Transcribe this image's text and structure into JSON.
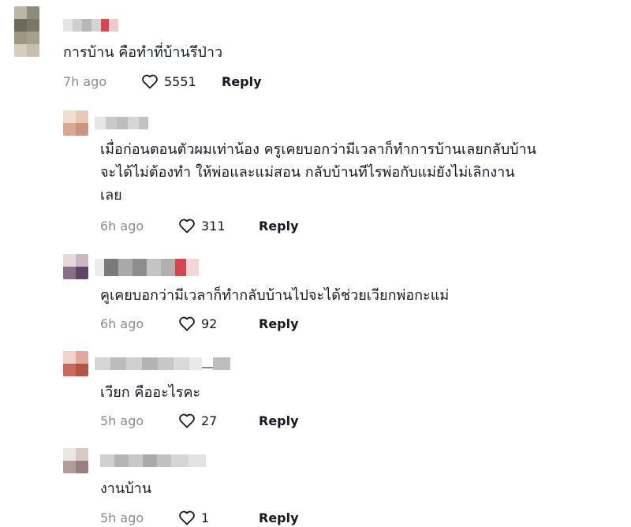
{
  "comments": [
    {
      "text": "การบ้าน คือทำที่บ้านรึป่าว",
      "time": "7h ago",
      "likes": "5551",
      "reply_label": "Reply",
      "icon": "heart-outline-icon"
    },
    {
      "text": "เมื่อก่อนตอนตัวผมเท่าน้อง ครูเคยบอกว่ามีเวลาก็ทำการบ้านเลยกลับบ้าน\nจะได้ไม่ต้องทำ ให้พ่อและแม่สอน กลับบ้านทีไรพ่อกับแม่ยังไม่เลิกงาน\nเลย",
      "time": "6h ago",
      "likes": "311",
      "reply_label": "Reply",
      "icon": "heart-outline-icon"
    },
    {
      "text": "คูเคยบอกว่ามีเวลาก็ทำกลับบ้านไปจะได้ช่วยเวียกพ่อกะแม่",
      "time": "6h ago",
      "likes": "92",
      "reply_label": "Reply",
      "icon": "heart-outline-icon"
    },
    {
      "text": "เวียก คืออะไรคะ",
      "time": "5h ago",
      "likes": "27",
      "reply_label": "Reply",
      "icon": "heart-outline-icon"
    },
    {
      "text": "งานบ้าน",
      "time": "5h ago",
      "likes": "1",
      "reply_label": "Reply",
      "icon": "heart-outline-icon"
    }
  ],
  "colors": {
    "text": "#161823",
    "muted": "#8a8b91",
    "accent_blur": "#d8454f"
  }
}
